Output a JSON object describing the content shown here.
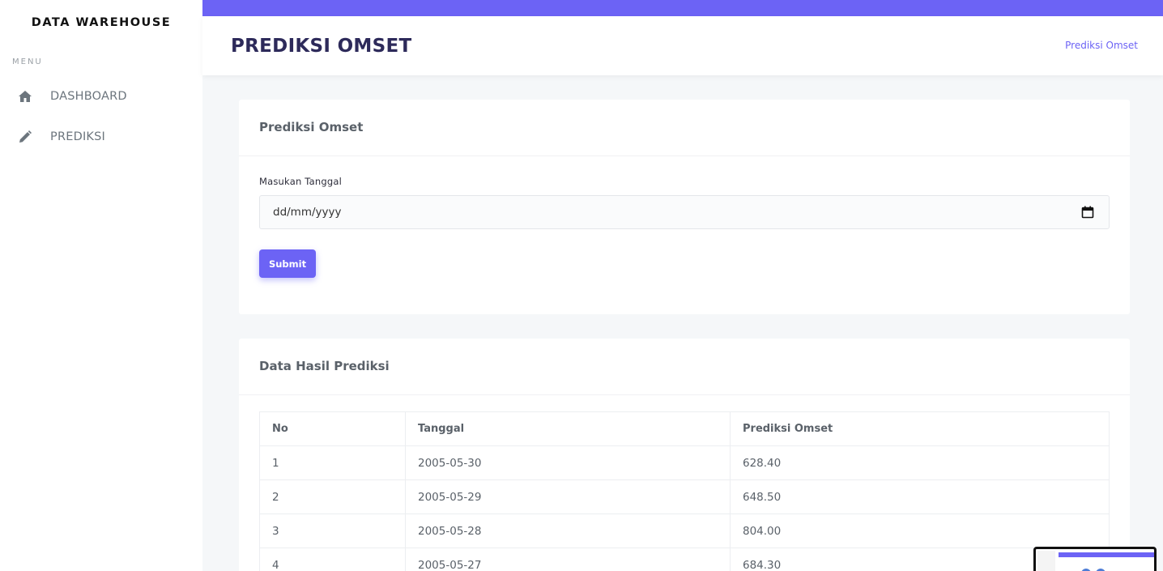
{
  "sidebar": {
    "brand": "DATA WAREHOUSE",
    "menu_label": "MENU",
    "items": [
      {
        "label": "DASHBOARD",
        "icon": "home-icon"
      },
      {
        "label": "PREDIKSI",
        "icon": "pencil-icon"
      }
    ]
  },
  "header": {
    "title": "PREDIKSI OMSET",
    "breadcrumb": "Prediksi Omset"
  },
  "form_card": {
    "title": "Prediksi Omset",
    "field_label": "Masukan Tanggal",
    "date_placeholder": "dd/mm/yyyy",
    "submit_label": "Submit"
  },
  "result_card": {
    "title": "Data Hasil Prediksi",
    "columns": [
      "No",
      "Tanggal",
      "Prediksi Omset"
    ],
    "rows": [
      [
        "1",
        "2005-05-30",
        "628.40"
      ],
      [
        "2",
        "2005-05-29",
        "648.50"
      ],
      [
        "3",
        "2005-05-28",
        "804.00"
      ],
      [
        "4",
        "2005-05-27",
        "684.30"
      ]
    ]
  },
  "colors": {
    "accent": "#6c63f5",
    "title": "#2d2a5a",
    "background": "#f5f7f9"
  }
}
